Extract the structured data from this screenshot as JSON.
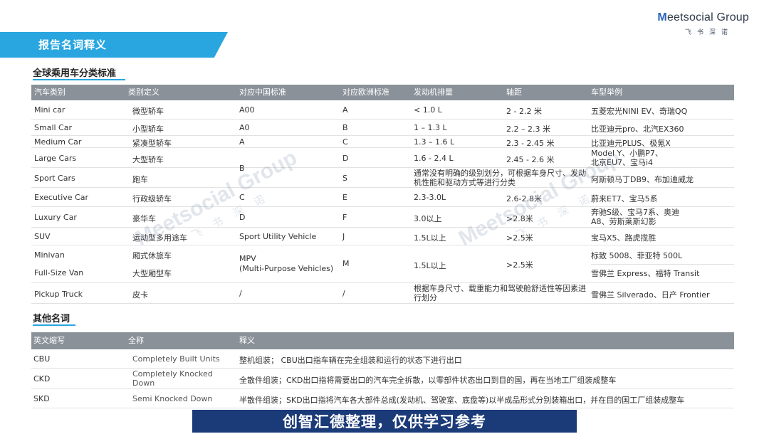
{
  "logo": {
    "mark": "M",
    "brand": "eetsocial Group",
    "sub": "飞书深诺"
  },
  "banner": {
    "title": "报告名词释义"
  },
  "section1": {
    "title": "全球乘用车分类标准",
    "headers": [
      "汽车类别",
      "类别定义",
      "对应中国标准",
      "对应欧洲标准",
      "发动机排量",
      "轴距",
      "车型举例"
    ],
    "rows": [
      [
        "Mini car",
        "微型轿车",
        "A00",
        "A",
        "< 1.0 L",
        "2 - 2.2 米",
        "五菱宏光NINI EV、奇瑞QQ"
      ],
      [
        "Small Car",
        "小型轿车",
        "A0",
        "B",
        "1 – 1.3 L",
        "2.2 – 2.3 米",
        "比亚迪元pro、北汽EX360"
      ],
      [
        "Medium Car",
        "紧凑型轿车",
        "A",
        "C",
        "1.3 – 1.6 L",
        "2.3 - 2.45 米",
        "比亚迪元PLUS、极氪X"
      ],
      [
        "Large Cars",
        "大型轿车",
        "",
        "D",
        "1.6 - 2.4 L",
        "2.45 - 2.6 米",
        "Model Y、小鹏P7、北京EU7、宝马i4"
      ],
      [
        "Sport Cars",
        "跑车",
        "",
        "S",
        "通常没有明确的级别划分，可根据车身尺寸、发动机性能和驱动方式等进行分类",
        "",
        "阿斯顿马丁DB9、布加迪威龙"
      ],
      [
        "Executive Car",
        "行政级轿车",
        "C",
        "E",
        "2.3-3.0L",
        "2.6-2.8米",
        "蔚来ET7、宝马5系"
      ],
      [
        "Luxury Car",
        "豪华车",
        "D",
        "F",
        "3.0以上",
        ">2.8米",
        "奔驰S级、宝马7系、奥迪A8、劳斯莱斯幻影"
      ],
      [
        "SUV",
        "运动型多用途车",
        "Sport Utility Vehicle",
        "J",
        "1.5L以上",
        ">2.5米",
        "宝马X5、路虎揽胜"
      ],
      [
        "Minivan",
        "厢式休旅车",
        "",
        "",
        "",
        "",
        "标致 5008、菲亚特 500L"
      ],
      [
        "Full-Size Van",
        "大型厢型车",
        "",
        "",
        "",
        "",
        "雪佛兰 Express、福特 Transit"
      ],
      [
        "Pickup Truck",
        "皮卡",
        "/",
        "/",
        "根据车身尺寸、载重能力和驾驶舱舒适性等因素进行划分",
        "",
        "雪佛兰 Silverado、日产 Frontier"
      ]
    ],
    "merged_b": "B",
    "mpv": {
      "std": "MPV\n(Multi-Purpose Vehicles)",
      "eu": "M",
      "engine": "1.5L以上",
      "wheelbase": ">2.5米"
    }
  },
  "section2": {
    "title": "其他名词",
    "headers": [
      "英文缩写",
      "全称",
      "释义"
    ],
    "rows": [
      [
        "CBU",
        "Completely Built Units",
        "整机组装；  CBU出口指车辆在完全组装和运行的状态下进行出口"
      ],
      [
        "CKD",
        "Completely Knocked Down",
        "全散件组装；CKD出口指将需要出口的汽车完全拆散，以零部件状态出口到目的国，再在当地工厂组装成整车"
      ],
      [
        "SKD",
        "Semi Knocked Down",
        "半散件组装；SKD出口指将汽车各大部件总成(发动机、驾驶室、底盘等)以半成品形式分别装箱出口，并在目的国工厂组装成整车"
      ]
    ]
  },
  "watermark": {
    "brand": "Meetsocial Group",
    "sub": "飞书深诺"
  },
  "caption": "创智汇德整理，仅供学习参考"
}
